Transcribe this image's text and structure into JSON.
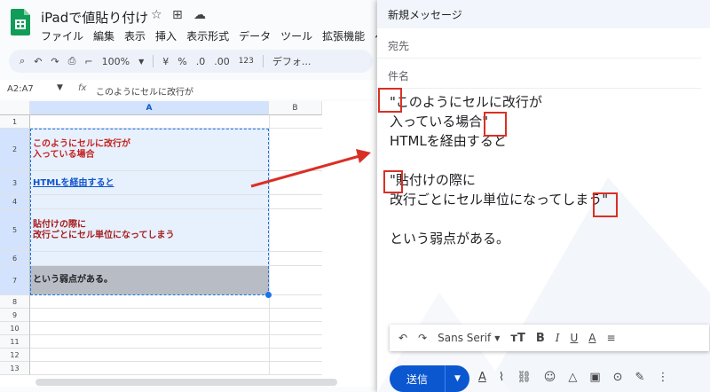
{
  "sheets": {
    "doc_title": "iPadで値貼り付け",
    "menu": [
      "ファイル",
      "編集",
      "表示",
      "挿入",
      "表示形式",
      "データ",
      "ツール",
      "拡張機能",
      "ヘ"
    ],
    "toolbar": {
      "zoom": "100%",
      "currency": "¥",
      "percent": "%",
      "dec_dec": ".0",
      "dec_inc": ".00",
      "number_format": "123",
      "font": "デフォ..."
    },
    "name_box": "A2:A7",
    "formula_text": "このようにセルに改行が",
    "columns": [
      "A",
      "B"
    ],
    "rows": [
      {
        "num": "1",
        "text": ""
      },
      {
        "num": "2",
        "text": "このようにセルに改行が\n入っている場合"
      },
      {
        "num": "3",
        "text": "HTMLを経由すると"
      },
      {
        "num": "4",
        "text": ""
      },
      {
        "num": "5",
        "text": "貼付けの際に\n改行ごとにセル単位になってしまう"
      },
      {
        "num": "6",
        "text": ""
      },
      {
        "num": "7",
        "text": "という弱点がある。"
      },
      {
        "num": "8",
        "text": ""
      },
      {
        "num": "9",
        "text": ""
      },
      {
        "num": "10",
        "text": ""
      },
      {
        "num": "11",
        "text": ""
      },
      {
        "num": "12",
        "text": ""
      },
      {
        "num": "13",
        "text": ""
      }
    ],
    "colors": {
      "red_text": "#c5221f",
      "link": "#1155cc",
      "selection": "#e7f0fd",
      "dark_row": "#b7bcc5"
    }
  },
  "gmail": {
    "header": "新規メッセージ",
    "to_label": "宛先",
    "subject_label": "件名",
    "body_lines": [
      "\"このようにセルに改行が",
      "入っている場合\"",
      "HTMLを経由すると",
      "",
      "\"貼付けの際に",
      "改行ごとにセル単位になってしまう\"",
      "",
      "という弱点がある。"
    ],
    "format": {
      "font": "Sans Serif"
    },
    "send_label": "送信"
  }
}
